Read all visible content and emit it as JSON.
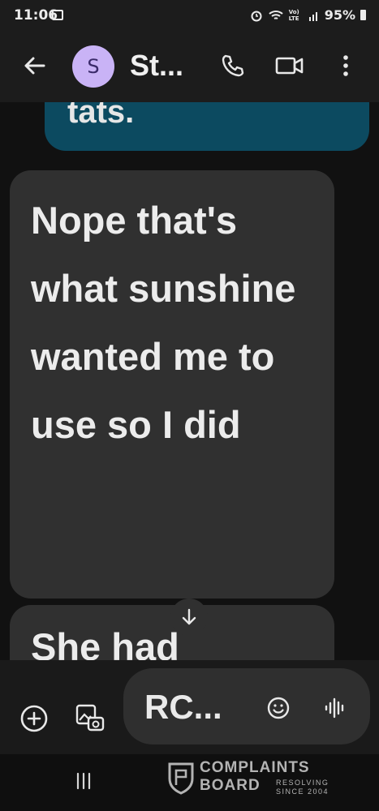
{
  "status_bar": {
    "time": "11:06",
    "network_label": "Vo) LTE",
    "battery": "95%"
  },
  "header": {
    "avatar_initial": "S",
    "contact_name": "St...",
    "icons": {
      "back": "arrow-left-icon",
      "call": "phone-icon",
      "video": "video-camera-icon",
      "more": "more-vert-icon"
    }
  },
  "messages": [
    {
      "type": "sent",
      "text": "tats."
    },
    {
      "type": "received",
      "text": "Nope that's what sunshine wanted me to use so I did"
    },
    {
      "type": "received",
      "text": "She had"
    }
  ],
  "compose": {
    "text": "RC...",
    "icons": {
      "add": "add-circle-icon",
      "gallery": "gallery-camera-icon",
      "emoji": "emoji-icon",
      "voice": "voice-waveform-icon"
    }
  },
  "watermark": {
    "line1": "COMPLAINTS",
    "line2": "BOARD",
    "tag1": "RESOLVING",
    "tag2": "SINCE 2004"
  },
  "colors": {
    "sent_bubble": "#0c4a60",
    "received_bubble": "#303030",
    "avatar": "#c9b3f6"
  }
}
